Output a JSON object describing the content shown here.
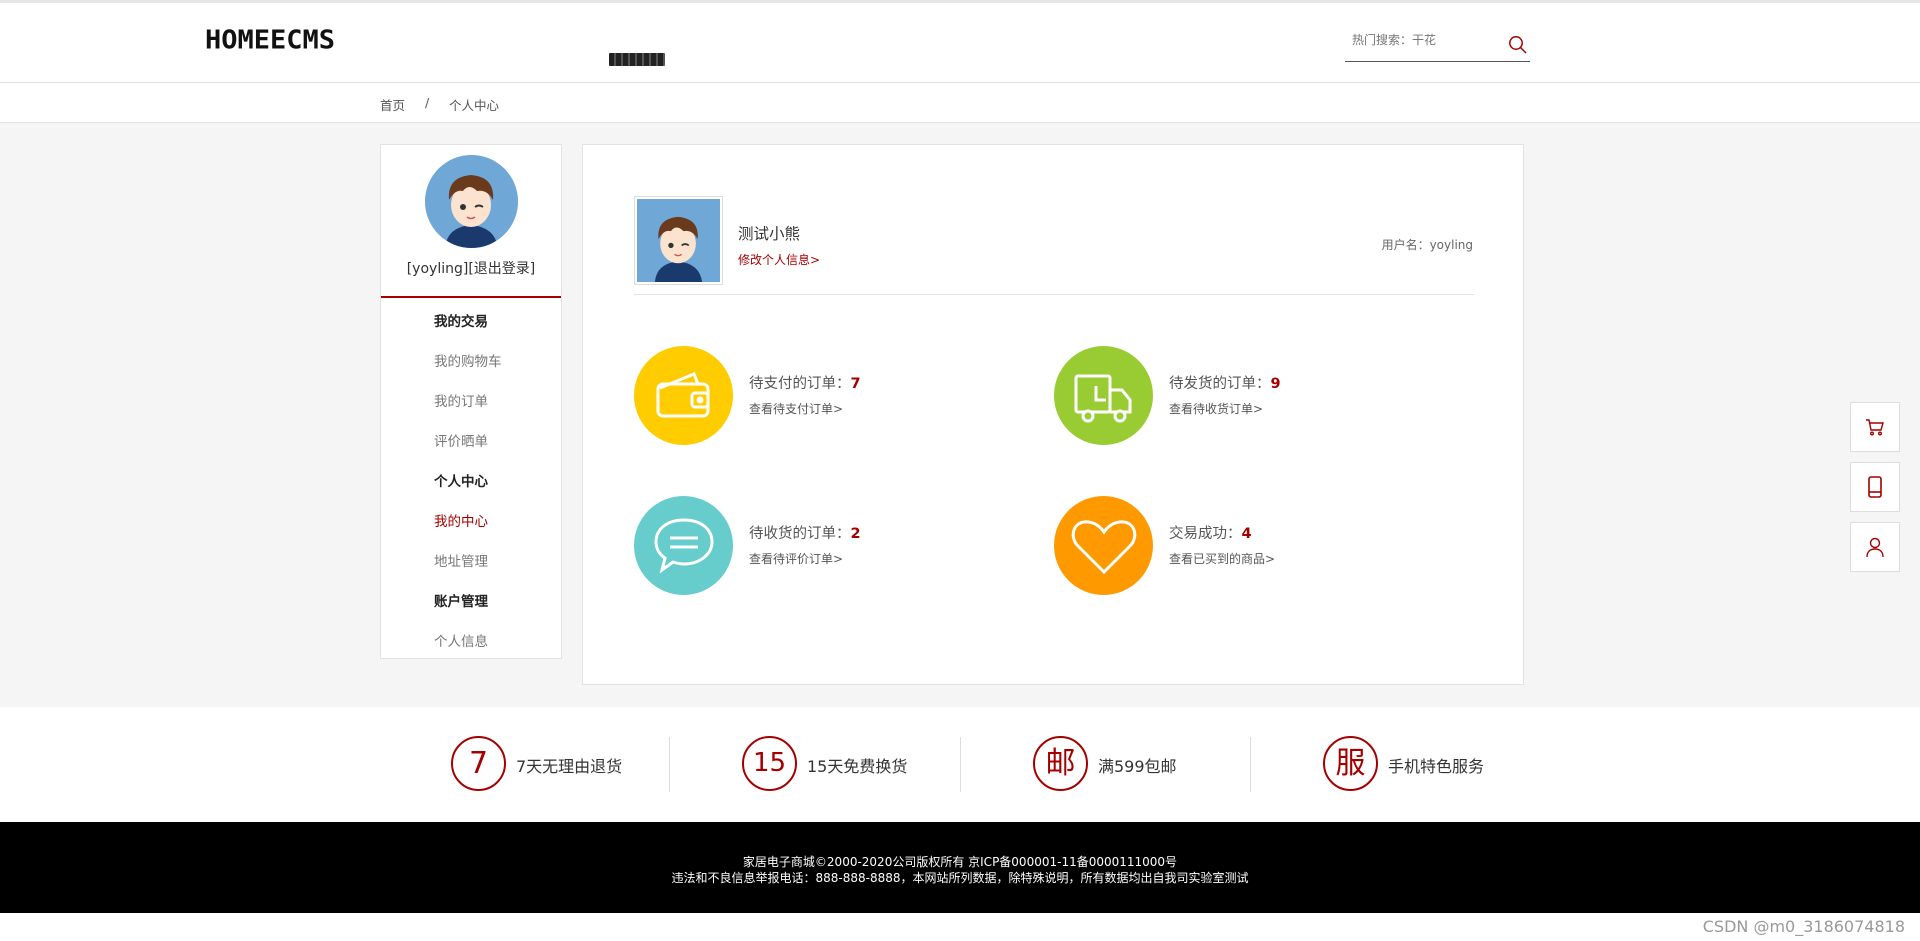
{
  "header": {
    "logo": "HOMEECMS",
    "search_placeholder": "热门搜索：干花"
  },
  "breadcrumb": {
    "home": "首页",
    "sep": "/",
    "current": "个人中心"
  },
  "sidebar": {
    "username": "[yoyling]",
    "logout": "[退出登录]",
    "menu": [
      {
        "label": "我的交易",
        "type": "group"
      },
      {
        "label": "我的购物车",
        "type": "item"
      },
      {
        "label": "我的订单",
        "type": "item"
      },
      {
        "label": "评价晒单",
        "type": "item"
      },
      {
        "label": "个人中心",
        "type": "group"
      },
      {
        "label": "我的中心",
        "type": "active"
      },
      {
        "label": "地址管理",
        "type": "item"
      },
      {
        "label": "账户管理",
        "type": "group"
      },
      {
        "label": "个人信息",
        "type": "item"
      }
    ]
  },
  "profile": {
    "nickname": "测试小熊",
    "edit_link": "修改个人信息>",
    "username_label": "用户名：yoyling"
  },
  "stats": [
    {
      "label": "待支付的订单：",
      "count": "7",
      "link": "查看待支付订单>",
      "color": "#ffcc00",
      "icon": "wallet-icon"
    },
    {
      "label": "待发货的订单：",
      "count": "9",
      "link": "查看待收货订单>",
      "color": "#99cc33",
      "icon": "truck-icon"
    },
    {
      "label": "待收货的订单：",
      "count": "2",
      "link": "查看待评价订单>",
      "color": "#66cccc",
      "icon": "chat-icon"
    },
    {
      "label": "交易成功：",
      "count": "4",
      "link": "查看已买到的商品>",
      "color": "#ff9900",
      "icon": "heart-icon"
    }
  ],
  "float_tools": [
    "cart-icon",
    "phone-icon",
    "user-icon"
  ],
  "services": [
    {
      "glyph": "7",
      "text": "7天无理由退货"
    },
    {
      "glyph": "15",
      "text": "15天免费换货"
    },
    {
      "glyph": "邮",
      "text": "满599包邮"
    },
    {
      "glyph": "服",
      "text": "手机特色服务"
    }
  ],
  "footer": {
    "line1": "家居电子商城©2000-2020公司版权所有 京ICP备000001-11备0000111000号",
    "line2": "违法和不良信息举报电话：888-888-8888，本网站所列数据，除特殊说明，所有数据均出自我司实验室测试"
  },
  "watermark": "CSDN @m0_3186074818",
  "colors": {
    "accent": "#a40000"
  }
}
